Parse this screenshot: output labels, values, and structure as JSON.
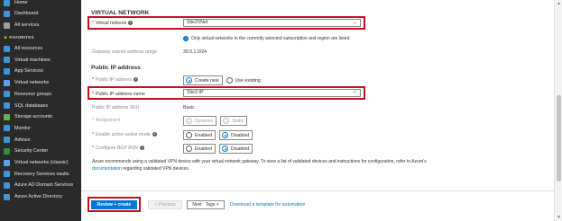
{
  "sidebar": {
    "items_top": [
      {
        "label": "Home",
        "color": "#3a96dd"
      },
      {
        "label": "Dashboard",
        "color": "#3a96dd"
      },
      {
        "label": "All services",
        "color": "#9e9e9e"
      }
    ],
    "favorites_label": "FAVORITES",
    "items": [
      {
        "label": "All resources",
        "color": "#3a96dd"
      },
      {
        "label": "Virtual machines",
        "color": "#3a96dd"
      },
      {
        "label": "App Services",
        "color": "#3a96dd"
      },
      {
        "label": "Virtual networks",
        "color": "#5ea0ef"
      },
      {
        "label": "Resource groups",
        "color": "#3a96dd"
      },
      {
        "label": "SQL databases",
        "color": "#3a96dd"
      },
      {
        "label": "Storage accounts",
        "color": "#68b04a"
      },
      {
        "label": "Monitor",
        "color": "#3a96dd"
      },
      {
        "label": "Advisor",
        "color": "#3a96dd"
      },
      {
        "label": "Security Center",
        "color": "#2d8f3c"
      },
      {
        "label": "Virtual networks (classic)",
        "color": "#5ea0ef"
      },
      {
        "label": "Recovery Services vaults",
        "color": "#3a96dd"
      },
      {
        "label": "Azure AD Domain Services",
        "color": "#3a96dd"
      },
      {
        "label": "Azure Active Directory",
        "color": "#3a96dd"
      }
    ]
  },
  "form": {
    "vnet_section": "VIRTUAL NETWORK",
    "virtual_network_label": "Virtual network",
    "virtual_network_value": "Site2VNet",
    "vnet_note": "Only virtual networks in the currently selected subscription and region are listed.",
    "gateway_subnet_label": "Gateway subnet address range",
    "gateway_subnet_value": "30.0.1.0/24",
    "pip_section": "Public IP address",
    "pip_label": "Public IP address",
    "pip_create_new": "Create new",
    "pip_use_existing": "Use existing",
    "pip_name_label": "Public IP address name",
    "pip_name_value": "Site2-IP",
    "pip_sku_label": "Public IP address SKU",
    "pip_sku_value": "Basic",
    "assignment_label": "Assignment",
    "assignment_dynamic": "Dynamic",
    "assignment_static": "Static",
    "active_active_label": "Enable active-active mode",
    "enabled": "Enabled",
    "disabled": "Disabled",
    "bgp_label": "Configure BGP ASN",
    "para_text": "Azure recommends using a validated VPN device with your virtual network gateway. To view a list of validated devices and instructions for configuration, refer to Azure's",
    "para_link": "documentation",
    "para_tail": "regarding validated VPN devices."
  },
  "footer": {
    "review_create": "Review + create",
    "previous": "< Previous",
    "next": "Next : Tags >",
    "download_template": "Download a template for automation"
  },
  "colors": {
    "accent": "#0078d4",
    "highlight_box": "#c50f1f",
    "sidebar_bg": "#2a2a2a"
  }
}
